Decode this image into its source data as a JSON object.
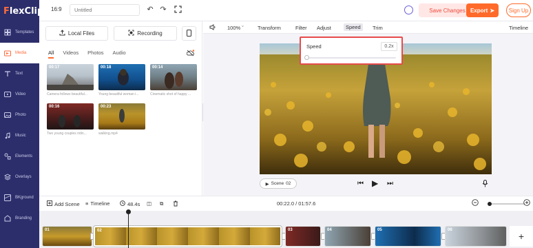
{
  "app": {
    "logo_prefix": "F",
    "logo_rest": "lexClip"
  },
  "sidebar": {
    "items": [
      {
        "label": "Templates",
        "icon": "templates-icon"
      },
      {
        "label": "Media",
        "icon": "media-icon",
        "active": true
      },
      {
        "label": "Text",
        "icon": "text-icon"
      },
      {
        "label": "Video",
        "icon": "video-icon"
      },
      {
        "label": "Photo",
        "icon": "photo-icon"
      },
      {
        "label": "Music",
        "icon": "music-icon"
      },
      {
        "label": "Elements",
        "icon": "elements-icon"
      },
      {
        "label": "Overlays",
        "icon": "overlays-icon"
      },
      {
        "label": "BKground",
        "icon": "background-icon"
      },
      {
        "label": "Branding",
        "icon": "branding-icon"
      }
    ]
  },
  "topbar": {
    "aspect_ratio": "16:9",
    "title_placeholder": "Untitled",
    "save_label": "Save Changes",
    "export_label": "Export",
    "signup_label": "Sign Up"
  },
  "media": {
    "local_files_label": "Local Files",
    "recording_label": "Recording",
    "tabs": [
      "All",
      "Videos",
      "Photos",
      "Audio"
    ],
    "active_tab": "All",
    "items": [
      {
        "duration": "00:17",
        "caption": "Camera follows beautiful..."
      },
      {
        "duration": "00:18",
        "caption": "Young beautiful woman i..."
      },
      {
        "duration": "00:14",
        "caption": "Cinematic shot of happy ..."
      },
      {
        "duration": "00:16",
        "caption": "Two young couples ridin..."
      },
      {
        "duration": "00:23",
        "caption": "walking.mp4"
      }
    ]
  },
  "editor": {
    "volume_icon": "volume-icon",
    "zoom": "100%",
    "tools": [
      "Transform",
      "Filter",
      "Adjust",
      "Speed",
      "Trim"
    ],
    "active_tool": "Speed",
    "timeline_label": "Timeline",
    "speed": {
      "label": "Speed",
      "value": "0.2x",
      "slider_fraction": 0.0
    },
    "scene_label": "Scene",
    "scene_number": "02"
  },
  "timeline": {
    "add_scene_label": "Add Scene",
    "timeline_label": "Timeline",
    "duration_label": "48.4s",
    "time_readout": "00:22.0 / 01:57.6",
    "zoom_fraction": 0.05,
    "clips": [
      "01",
      "02",
      "03",
      "04",
      "05",
      "06"
    ],
    "selected_clip": "02"
  },
  "colors": {
    "sidebar_bg": "#2c2e6b",
    "accent": "#ff6a2a",
    "highlight_border": "#e84a4a"
  }
}
